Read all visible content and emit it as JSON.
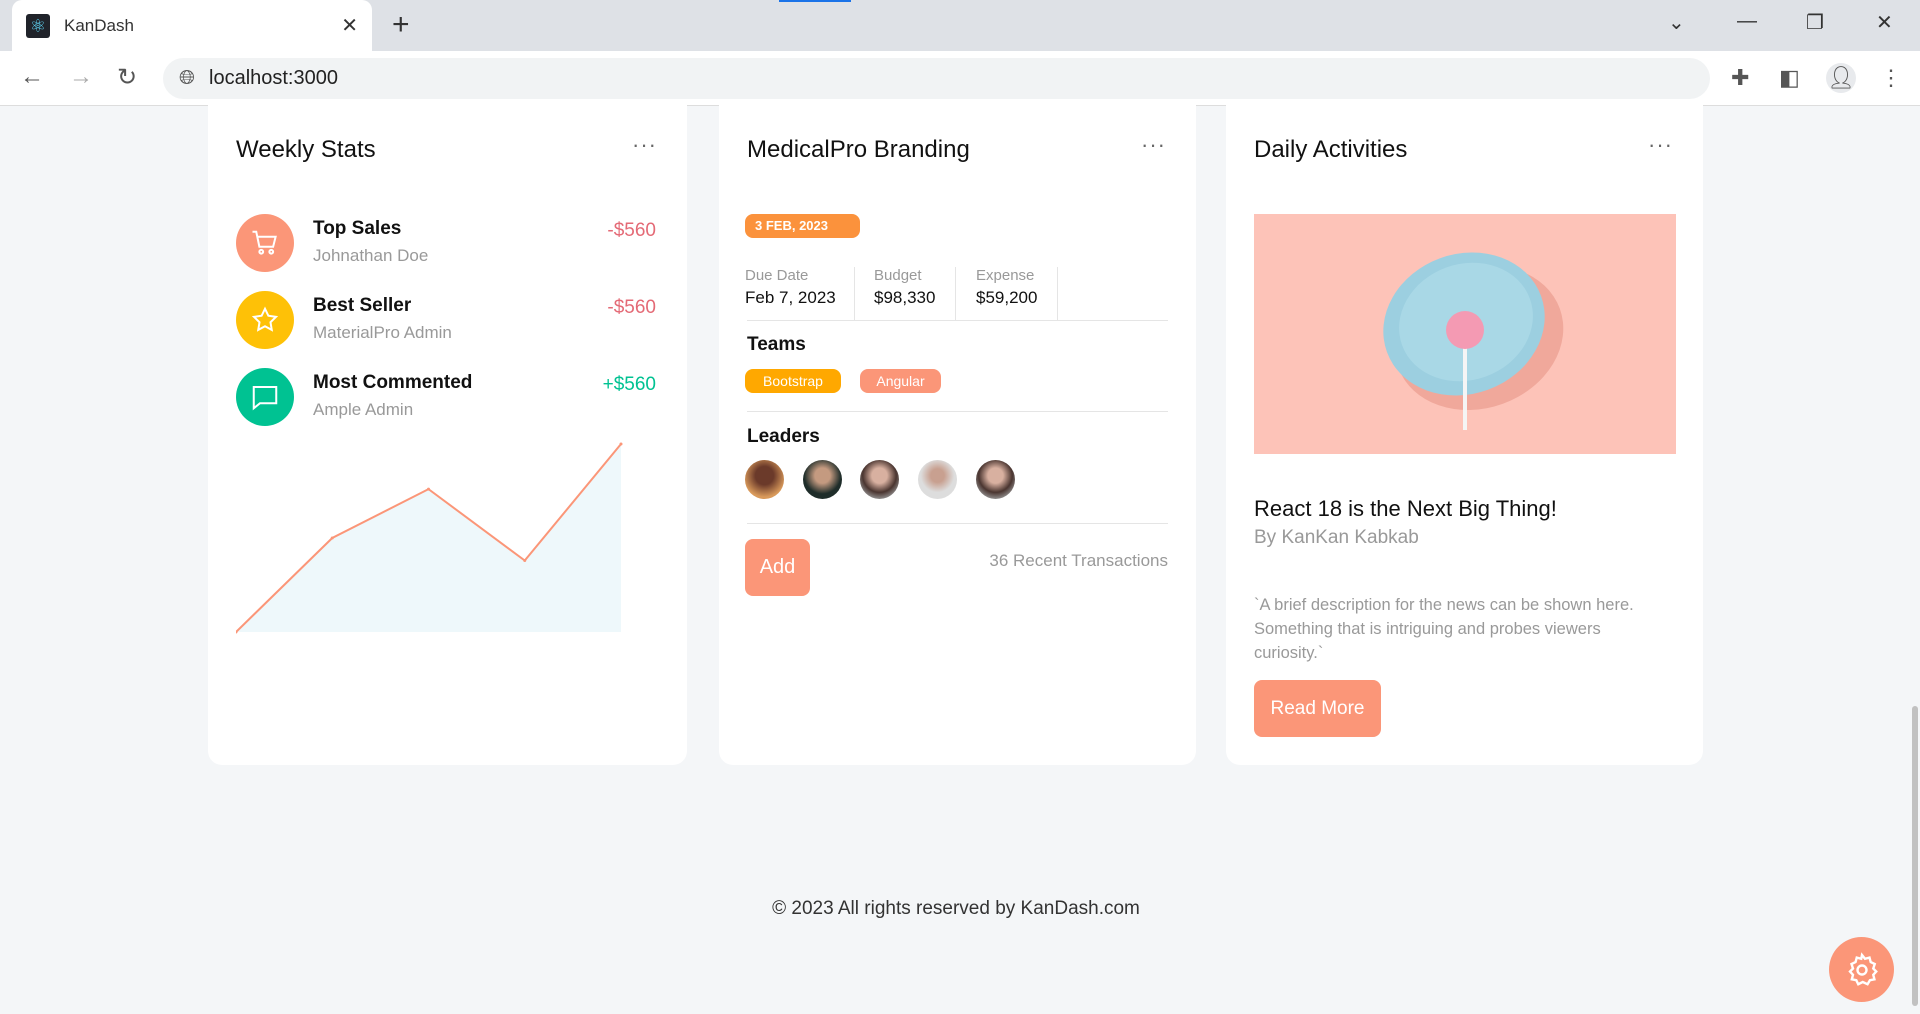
{
  "browser": {
    "tab_title": "KanDash",
    "url": "localhost:3000"
  },
  "weekly": {
    "title": "Weekly Stats",
    "items": [
      {
        "title": "Top Sales",
        "subtitle": "Johnathan Doe",
        "amount": "-$560",
        "icon": "cart-icon",
        "color": "#fb9678",
        "amount_color": "#e46a76"
      },
      {
        "title": "Best Seller",
        "subtitle": "MaterialPro Admin",
        "amount": "-$560",
        "icon": "star-icon",
        "color": "#fec107",
        "amount_color": "#e46a76"
      },
      {
        "title": "Most Commented",
        "subtitle": "Ample Admin",
        "amount": "+$560",
        "icon": "comment-icon",
        "color": "#00c292",
        "amount_color": "#00c292"
      }
    ],
    "chart_data": {
      "type": "area",
      "values": [
        0,
        50,
        76,
        38,
        100
      ],
      "color": "#fb9678",
      "fill": "#eef8fb"
    }
  },
  "branding": {
    "title": "MedicalPro Branding",
    "date_badge": "3 FEB, 2023",
    "stats": [
      {
        "label": "Due Date",
        "value": "Feb 7, 2023"
      },
      {
        "label": "Budget",
        "value": "$98,330"
      },
      {
        "label": "Expense",
        "value": "$59,200"
      }
    ],
    "teams_label": "Teams",
    "teams": [
      {
        "name": "Bootstrap",
        "color": "#ffa800"
      },
      {
        "name": "Angular",
        "color": "#fb9678"
      }
    ],
    "leaders_label": "Leaders",
    "add_label": "Add",
    "transactions": "36 Recent Transactions"
  },
  "daily": {
    "title": "Daily Activities",
    "headline": "React 18 is the Next Big Thing!",
    "author": "By KanKan Kabkab",
    "description": "`A brief description for the news can be shown here. Something that is intriguing and probes viewers curiosity.`",
    "read_more": "Read More"
  },
  "footer": "© 2023 All rights reserved by KanDash.com",
  "accent": "#fb9678"
}
